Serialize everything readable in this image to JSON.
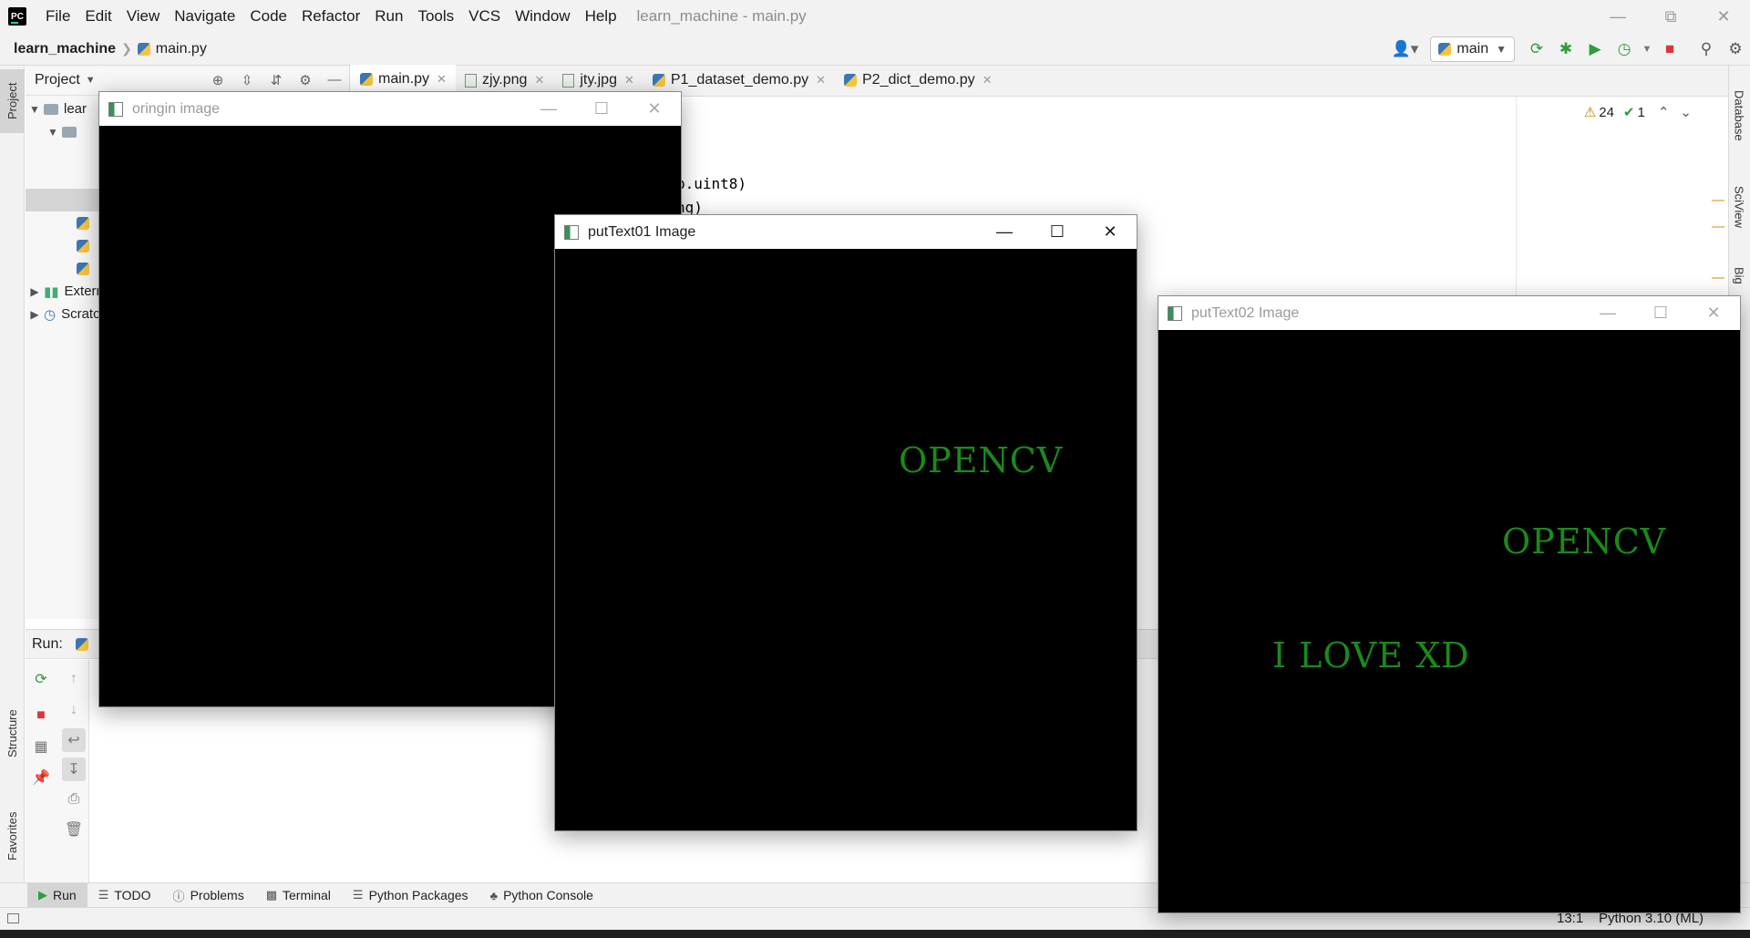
{
  "menubar": {
    "logo": "PC",
    "items": [
      "File",
      "Edit",
      "View",
      "Navigate",
      "Code",
      "Refactor",
      "Run",
      "Tools",
      "VCS",
      "Window",
      "Help"
    ],
    "title": "learn_machine - main.py"
  },
  "navbar": {
    "project": "learn_machine",
    "file": "main.py",
    "run_config": "main"
  },
  "left_stripe": {
    "project_tab": "Project",
    "structure_tab": "Structure",
    "favorites_tab": "Favorites"
  },
  "right_stripe": {
    "database_tab": "Database",
    "sciview_tab": "SciView",
    "big_tab": "Big"
  },
  "project_panel": {
    "title": "Project",
    "rows": [
      "lear",
      "External Libraries",
      "Scratches and Consoles"
    ]
  },
  "editor_tabs": [
    {
      "label": "main.py",
      "kind": "py"
    },
    {
      "label": "zjy.png",
      "kind": "img"
    },
    {
      "label": "jty.jpg",
      "kind": "img"
    },
    {
      "label": "P1_dataset_demo.py",
      "kind": "py"
    },
    {
      "label": "P2_dict_demo.py",
      "kind": "py"
    }
  ],
  "editor": {
    "code_line_1": "p.uint8)",
    "code_line_2": "ng)",
    "warnings": "24",
    "checks": "1"
  },
  "run_panel": {
    "label": "Run:"
  },
  "bottom_tabs": [
    "Run",
    "TODO",
    "Problems",
    "Terminal",
    "Python Packages",
    "Python Console"
  ],
  "status": {
    "position": "13:1",
    "interpreter": "Python 3.10 (ML)"
  },
  "windows": {
    "orig": {
      "title": "oringin image"
    },
    "put1": {
      "title": "putText01 Image",
      "text1": "OPENCV"
    },
    "put2": {
      "title": "putText02 Image",
      "text1": "OPENCV",
      "text2": "I LOVE XD"
    }
  },
  "colors": {
    "accent": "#4083c9",
    "cv_text": "#1a8a1a",
    "run_green": "#2e9c3a",
    "stop_red": "#d9373d"
  }
}
